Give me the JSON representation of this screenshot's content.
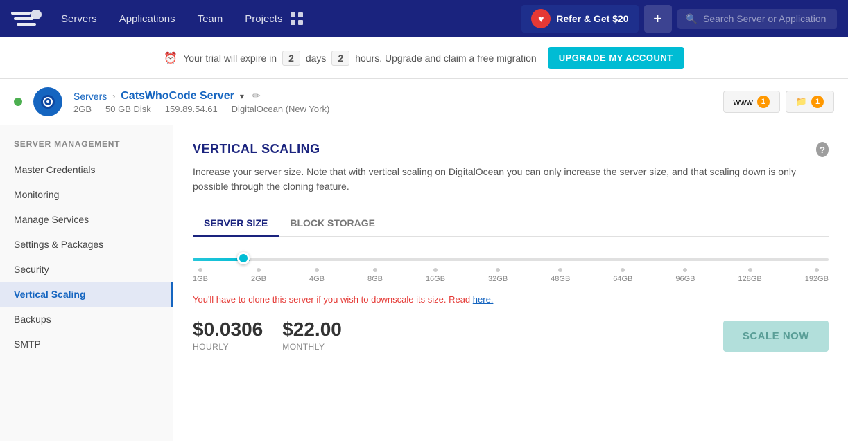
{
  "nav": {
    "logo_label": "Cloudways",
    "links": [
      "Servers",
      "Applications",
      "Team",
      "Projects"
    ],
    "refer_label": "Refer & Get $20",
    "plus_label": "+",
    "search_placeholder": "Search Server or Application"
  },
  "trial_bar": {
    "text_before": "Your trial will expire in",
    "days_value": "2",
    "days_label": "days",
    "hours_value": "2",
    "hours_label": "hours. Upgrade and claim a free migration",
    "upgrade_btn": "UPGRADE MY ACCOUNT"
  },
  "server_header": {
    "breadcrumb_servers": "Servers",
    "server_name": "CatsWhoCode Server",
    "ram": "2GB",
    "disk": "50 GB Disk",
    "ip": "159.89.54.61",
    "provider": "DigitalOcean (New York)",
    "www_badge": "1",
    "folder_badge": "1"
  },
  "sidebar": {
    "section_title": "Server Management",
    "items": [
      {
        "label": "Master Credentials",
        "active": false
      },
      {
        "label": "Monitoring",
        "active": false
      },
      {
        "label": "Manage Services",
        "active": false
      },
      {
        "label": "Settings & Packages",
        "active": false
      },
      {
        "label": "Security",
        "active": false
      },
      {
        "label": "Vertical Scaling",
        "active": true
      },
      {
        "label": "Backups",
        "active": false
      },
      {
        "label": "SMTP",
        "active": false
      }
    ]
  },
  "content": {
    "title": "VERTICAL SCALING",
    "description": "Increase your server size. Note that with vertical scaling on DigitalOcean you can only increase the server size, and that scaling down is only possible through the cloning feature.",
    "tabs": [
      {
        "label": "SERVER SIZE",
        "active": true
      },
      {
        "label": "BLOCK STORAGE",
        "active": false
      }
    ],
    "slider_sizes": [
      "1GB",
      "2GB",
      "4GB",
      "8GB",
      "16GB",
      "32GB",
      "48GB",
      "64GB",
      "96GB",
      "128GB",
      "192GB"
    ],
    "clone_warning": "You'll have to clone this server if you wish to downscale its size. Read",
    "clone_link": "here.",
    "hourly_price": "$0.0306",
    "hourly_label": "HOURLY",
    "monthly_price": "$22.00",
    "monthly_label": "MONTHLY",
    "scale_btn": "SCALE NOW",
    "help_label": "?"
  }
}
